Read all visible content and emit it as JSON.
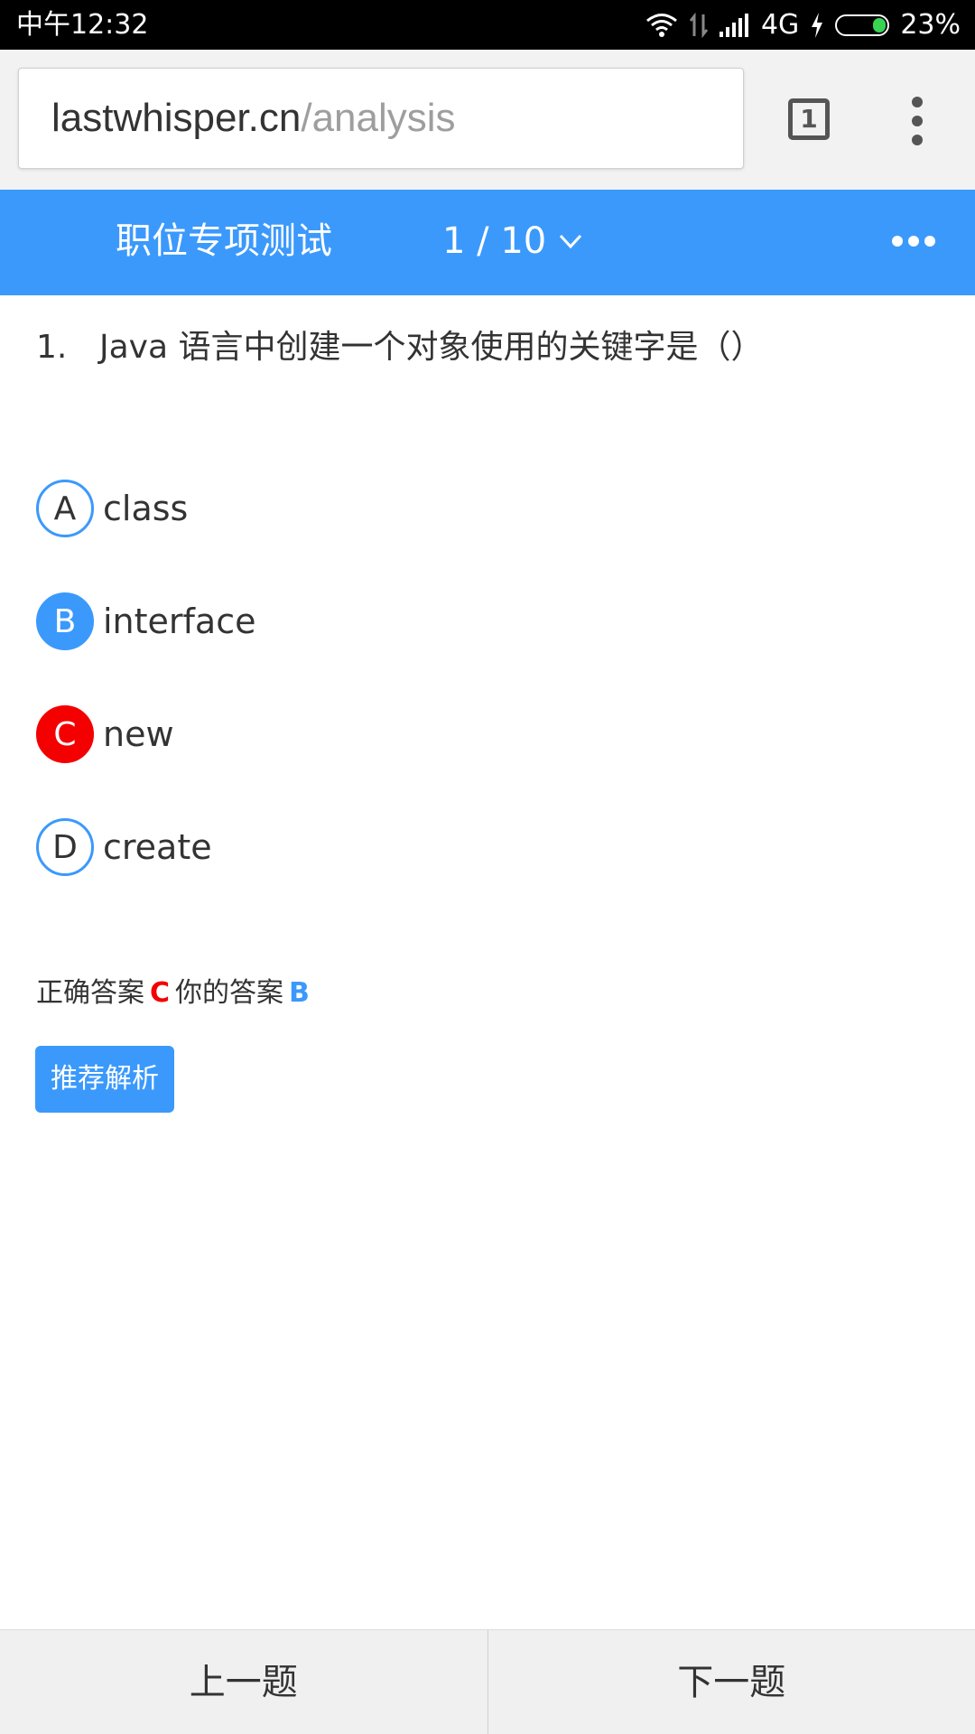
{
  "status_bar": {
    "time": "中午12:32",
    "network": "4G",
    "battery": "23%",
    "battery_color": "#39d353"
  },
  "browser": {
    "url_host": "lastwhisper.cn",
    "url_path": "/analysis",
    "tab_count": "1",
    "icons": [
      "tabs-icon",
      "overflow-menu-icon"
    ]
  },
  "header": {
    "title": "职位专项测试",
    "progress": "1 / 10",
    "accent": "#3b99fc"
  },
  "question": {
    "number": "1.",
    "text": "Java  语言中创建一个对象使用的关键字是（）",
    "options": [
      {
        "letter": "A",
        "text": "class",
        "state": "unselected"
      },
      {
        "letter": "B",
        "text": "interface",
        "state": "user-answer"
      },
      {
        "letter": "C",
        "text": "new",
        "state": "correct"
      },
      {
        "letter": "D",
        "text": "create",
        "state": "unselected"
      }
    ]
  },
  "result": {
    "correct_label": "正确答案",
    "correct_value": "C",
    "your_label": "你的答案",
    "your_value": "B",
    "correct_color": "#f40000"
  },
  "analysis_button": "推荐解析",
  "nav": {
    "prev": "上一题",
    "next": "下一题"
  }
}
